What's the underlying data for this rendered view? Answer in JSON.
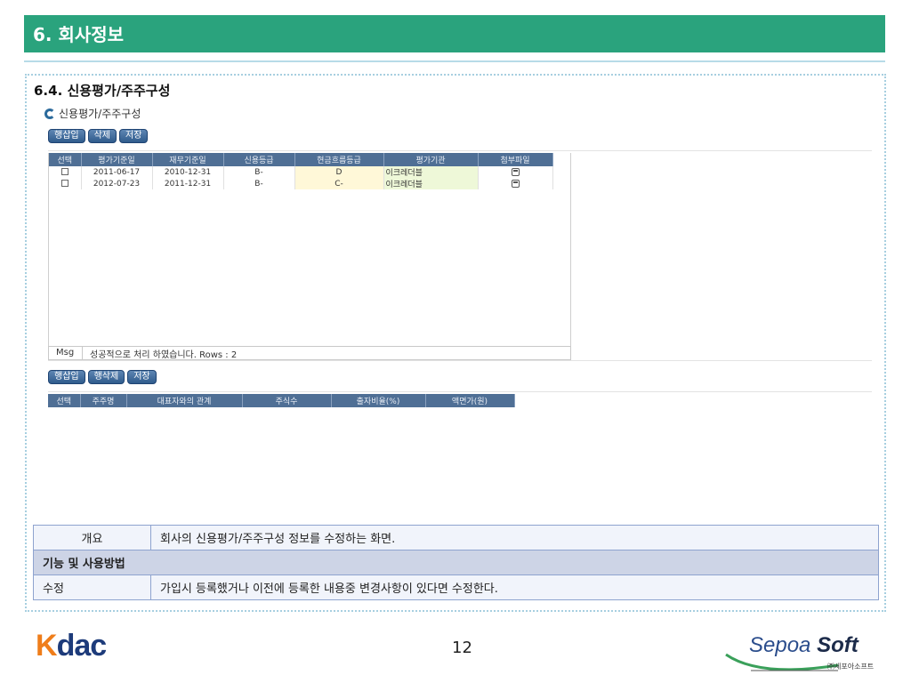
{
  "header": {
    "title": "6. 회사정보"
  },
  "section": {
    "title": "6.4. 신용평가/주주구성"
  },
  "screen": {
    "title": "신용평가/주주구성",
    "top_buttons": [
      "행삽입",
      "삭제",
      "저장"
    ],
    "credit_grid": {
      "columns": [
        "선택",
        "평가기준일",
        "재무기준일",
        "신용등급",
        "현금흐름등급",
        "평가기관",
        "첨부파일"
      ],
      "rows": [
        {
          "eval_date": "2011-06-17",
          "fin_date": "2010-12-31",
          "grade": "B-",
          "cash_grade": "D",
          "agency": "이크레더블"
        },
        {
          "eval_date": "2012-07-23",
          "fin_date": "2011-12-31",
          "grade": "B-",
          "cash_grade": "C-",
          "agency": "이크레더블"
        }
      ]
    },
    "msg": {
      "label": "Msg",
      "text": "성공적으로 처리 하였습니다. Rows : 2"
    },
    "bottom_buttons": [
      "행삽입",
      "행삭제",
      "저장"
    ],
    "share_grid": {
      "columns": [
        "선택",
        "주주명",
        "대표자와의 관계",
        "주식수",
        "출자비율(%)",
        "액면가(원)"
      ]
    }
  },
  "info": {
    "overview_key": "개요",
    "overview_value": "회사의 신용평가/주주구성 정보를 수정하는 화면.",
    "band": "기능 및 사용방법",
    "edit_key": "수정",
    "edit_value": "가입시 등록했거나 이전에 등록한 내용중 변경사항이 있다면 수정한다."
  },
  "footer": {
    "logo_left_a": "K",
    "logo_left_b": "dac",
    "page": "12",
    "logo_right_a": "Sepoa ",
    "logo_right_b": "Soft",
    "logo_right_sub": "㈜세포아소프트"
  }
}
